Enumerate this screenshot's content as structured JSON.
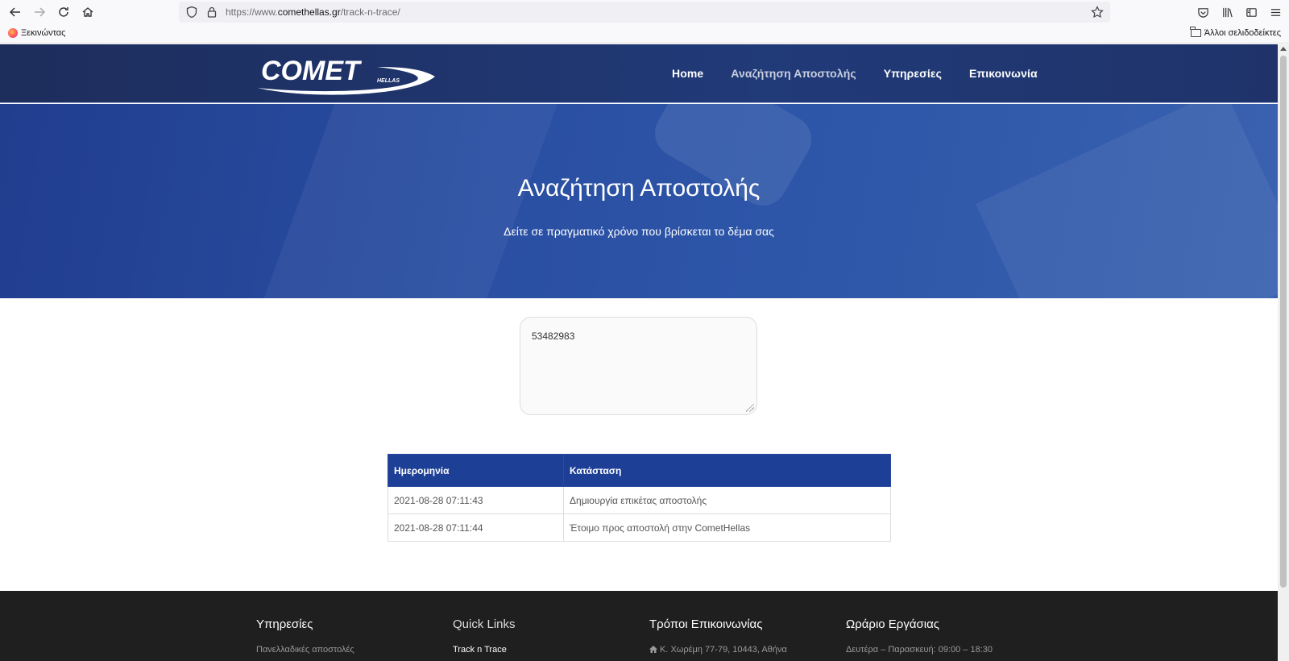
{
  "browser": {
    "url_prefix": "https://www.",
    "url_domain": "comethellas.gr",
    "url_path": "/track-n-trace/",
    "bookmark_left": "Ξεκινώντας",
    "bookmark_right": "Άλλοι σελιδοδείκτες"
  },
  "header": {
    "logo_text": "COMET",
    "logo_sub": "HELLAS",
    "nav": [
      "Home",
      "Αναζήτηση Αποστολής",
      "Υπηρεσίες",
      "Επικοινωνία"
    ],
    "active_nav": "Αναζήτηση Αποστολής"
  },
  "hero": {
    "title": "Αναζήτηση Αποστολής",
    "subtitle": "Δείτε σε πραγματικό χρόνο που βρίσκεται το δέμα σας"
  },
  "tracking": {
    "input_value": "53482983"
  },
  "results": {
    "headers": [
      "Ημερομηνία",
      "Κατάσταση"
    ],
    "rows": [
      [
        "2021-08-28 07:11:43",
        "Δημιουργία επικέτας αποστολής"
      ],
      [
        "2021-08-28 07:11:44",
        "Έτοιμο προς αποστολή στην CometHellas"
      ]
    ]
  },
  "footer": {
    "columns": [
      {
        "title": "Υπηρεσίες",
        "line": "Πανελλαδικές αποστολές"
      },
      {
        "title": "Quick Links",
        "line": "Track n Trace"
      },
      {
        "title": "Τρόποι Επικοινωνίας",
        "line": "Κ. Χωρέμη 77-79, 10443, Αθήνα"
      },
      {
        "title": "Ωράριο Εργάσιας",
        "line": "Δευτέρα – Παρασκευή: 09:00 – 18:30"
      }
    ]
  },
  "colors": {
    "header_bg": "#1d2d5c",
    "hero_bg": "#2a4fa3",
    "table_header": "#1d3f96",
    "footer_bg": "#1f1f1f"
  }
}
